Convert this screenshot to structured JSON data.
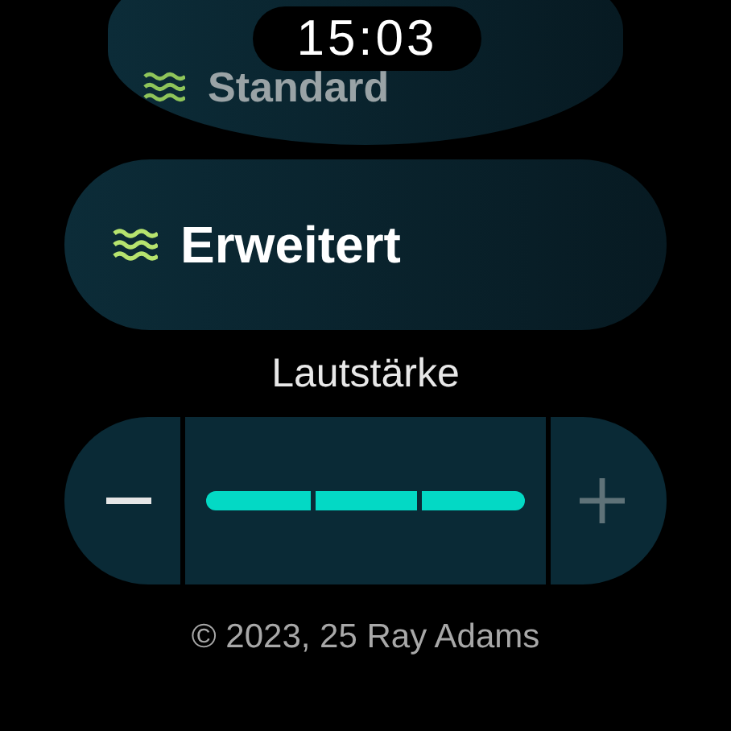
{
  "clock": "15:03",
  "modes": [
    {
      "label": "Standard",
      "faded": true
    },
    {
      "label": "Erweitert",
      "faded": false
    }
  ],
  "volume": {
    "label": "Lautstärke",
    "level": 1,
    "decrease_disabled": false,
    "increase_disabled": true
  },
  "footer": "© 2023, 25 Ray Adams"
}
